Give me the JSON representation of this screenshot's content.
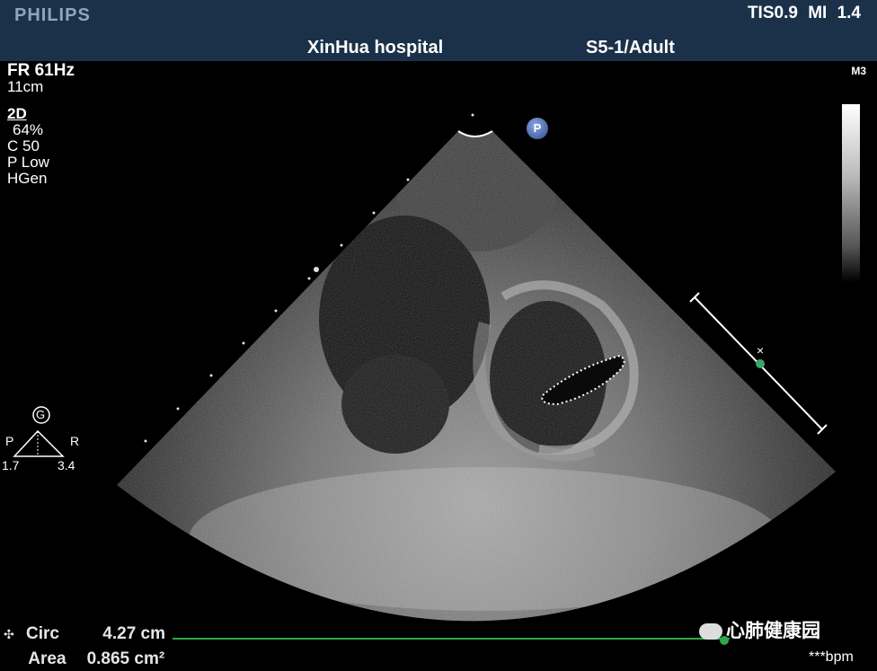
{
  "header": {
    "brand": "PHILIPS",
    "indices": "TIS0.9   MI 1.4",
    "hospital": "XinHua hospital",
    "probe_preset": "S5-1/Adult"
  },
  "imaging_params": {
    "frame_rate": "FR 61Hz",
    "depth": "11cm",
    "mode": "2D",
    "gain": "64%",
    "compression": "C 50",
    "persistence": "P Low",
    "resolution": "HGen"
  },
  "grayscale_bar_label": "M3",
  "orientation_marker": {
    "label": "P",
    "focus_label": "G",
    "left_label": "P",
    "right_label": "R",
    "left_value": "1.7",
    "right_value": "3.4"
  },
  "measurements": [
    {
      "label": "Circ",
      "value": "4.27 cm"
    },
    {
      "label": "Area",
      "value": "0.865 cm²"
    }
  ],
  "watermark": "心肺健康园",
  "heart_rate": "***bpm"
}
